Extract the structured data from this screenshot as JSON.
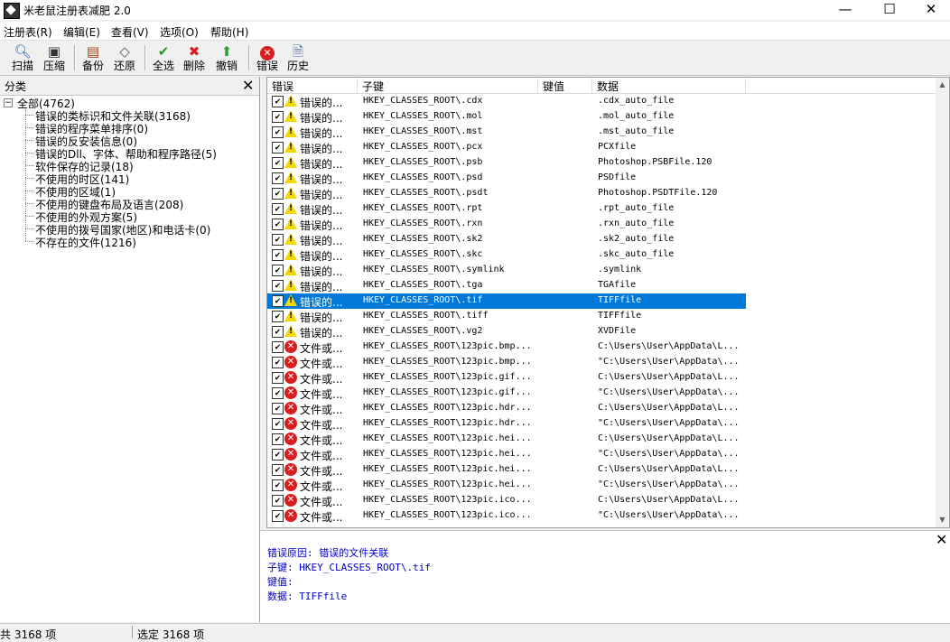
{
  "window": {
    "title": "米老鼠注册表减肥 2.0",
    "minimize": "—",
    "maximize": "☐",
    "close": "✕"
  },
  "menu": [
    "注册表(R)",
    "编辑(E)",
    "查看(V)",
    "选项(O)",
    "帮助(H)"
  ],
  "toolbar": {
    "scan": "扫描",
    "compress": "压缩",
    "backup": "备份",
    "restore": "还原",
    "select_all": "全选",
    "delete": "删除",
    "undo": "撤销",
    "errors": "错误",
    "history": "历史"
  },
  "sidebar": {
    "title": "分类",
    "root": "全部(4762)",
    "items": [
      "错误的类标识和文件关联(3168)",
      "错误的程序菜单排序(0)",
      "错误的反安装信息(0)",
      "错误的Dll、字体、帮助和程序路径(5)",
      "软件保存的记录(18)",
      "不使用的时区(141)",
      "不使用的区域(1)",
      "不使用的键盘布局及语言(208)",
      "不使用的外观方案(5)",
      "不使用的拨号国家(地区)和电话卡(0)",
      "不存在的文件(1216)"
    ]
  },
  "list": {
    "columns": [
      "错误",
      "子键",
      "键值",
      "数据"
    ],
    "rows": [
      {
        "icon": "warning",
        "error": "错误的...",
        "key": "HKEY_CLASSES_ROOT\\.cdx",
        "value": "",
        "data": ".cdx_auto_file"
      },
      {
        "icon": "warning",
        "error": "错误的...",
        "key": "HKEY_CLASSES_ROOT\\.mol",
        "value": "",
        "data": ".mol_auto_file"
      },
      {
        "icon": "warning",
        "error": "错误的...",
        "key": "HKEY_CLASSES_ROOT\\.mst",
        "value": "",
        "data": ".mst_auto_file"
      },
      {
        "icon": "warning",
        "error": "错误的...",
        "key": "HKEY_CLASSES_ROOT\\.pcx",
        "value": "",
        "data": "PCXfile"
      },
      {
        "icon": "warning",
        "error": "错误的...",
        "key": "HKEY_CLASSES_ROOT\\.psb",
        "value": "",
        "data": "Photoshop.PSBFile.120"
      },
      {
        "icon": "warning",
        "error": "错误的...",
        "key": "HKEY_CLASSES_ROOT\\.psd",
        "value": "",
        "data": "PSDfile"
      },
      {
        "icon": "warning",
        "error": "错误的...",
        "key": "HKEY_CLASSES_ROOT\\.psdt",
        "value": "",
        "data": "Photoshop.PSDTFile.120"
      },
      {
        "icon": "warning",
        "error": "错误的...",
        "key": "HKEY_CLASSES_ROOT\\.rpt",
        "value": "",
        "data": ".rpt_auto_file"
      },
      {
        "icon": "warning",
        "error": "错误的...",
        "key": "HKEY_CLASSES_ROOT\\.rxn",
        "value": "",
        "data": ".rxn_auto_file"
      },
      {
        "icon": "warning",
        "error": "错误的...",
        "key": "HKEY_CLASSES_ROOT\\.sk2",
        "value": "",
        "data": ".sk2_auto_file"
      },
      {
        "icon": "warning",
        "error": "错误的...",
        "key": "HKEY_CLASSES_ROOT\\.skc",
        "value": "",
        "data": ".skc_auto_file"
      },
      {
        "icon": "warning",
        "error": "错误的...",
        "key": "HKEY_CLASSES_ROOT\\.symlink",
        "value": "",
        "data": ".symlink"
      },
      {
        "icon": "warning",
        "error": "错误的...",
        "key": "HKEY_CLASSES_ROOT\\.tga",
        "value": "",
        "data": "TGAfile"
      },
      {
        "icon": "warning",
        "error": "错误的...",
        "key": "HKEY_CLASSES_ROOT\\.tif",
        "value": "",
        "data": "TIFFfile",
        "selected": true
      },
      {
        "icon": "warning",
        "error": "错误的...",
        "key": "HKEY_CLASSES_ROOT\\.tiff",
        "value": "",
        "data": "TIFFfile"
      },
      {
        "icon": "warning",
        "error": "错误的...",
        "key": "HKEY_CLASSES_ROOT\\.vg2",
        "value": "",
        "data": "XVDFile"
      },
      {
        "icon": "error",
        "error": "文件或...",
        "key": "HKEY_CLASSES_ROOT\\123pic.bmp...",
        "value": "",
        "data": "C:\\Users\\User\\AppData\\L..."
      },
      {
        "icon": "error",
        "error": "文件或...",
        "key": "HKEY_CLASSES_ROOT\\123pic.bmp...",
        "value": "",
        "data": "\"C:\\Users\\User\\AppData\\..."
      },
      {
        "icon": "error",
        "error": "文件或...",
        "key": "HKEY_CLASSES_ROOT\\123pic.gif...",
        "value": "",
        "data": "C:\\Users\\User\\AppData\\L..."
      },
      {
        "icon": "error",
        "error": "文件或...",
        "key": "HKEY_CLASSES_ROOT\\123pic.gif...",
        "value": "",
        "data": "\"C:\\Users\\User\\AppData\\..."
      },
      {
        "icon": "error",
        "error": "文件或...",
        "key": "HKEY_CLASSES_ROOT\\123pic.hdr...",
        "value": "",
        "data": "C:\\Users\\User\\AppData\\L..."
      },
      {
        "icon": "error",
        "error": "文件或...",
        "key": "HKEY_CLASSES_ROOT\\123pic.hdr...",
        "value": "",
        "data": "\"C:\\Users\\User\\AppData\\..."
      },
      {
        "icon": "error",
        "error": "文件或...",
        "key": "HKEY_CLASSES_ROOT\\123pic.hei...",
        "value": "",
        "data": "C:\\Users\\User\\AppData\\L..."
      },
      {
        "icon": "error",
        "error": "文件或...",
        "key": "HKEY_CLASSES_ROOT\\123pic.hei...",
        "value": "",
        "data": "\"C:\\Users\\User\\AppData\\..."
      },
      {
        "icon": "error",
        "error": "文件或...",
        "key": "HKEY_CLASSES_ROOT\\123pic.hei...",
        "value": "",
        "data": "C:\\Users\\User\\AppData\\L..."
      },
      {
        "icon": "error",
        "error": "文件或...",
        "key": "HKEY_CLASSES_ROOT\\123pic.hei...",
        "value": "",
        "data": "\"C:\\Users\\User\\AppData\\..."
      },
      {
        "icon": "error",
        "error": "文件或...",
        "key": "HKEY_CLASSES_ROOT\\123pic.ico...",
        "value": "",
        "data": "C:\\Users\\User\\AppData\\L..."
      },
      {
        "icon": "error",
        "error": "文件或...",
        "key": "HKEY_CLASSES_ROOT\\123pic.ico...",
        "value": "",
        "data": "\"C:\\Users\\User\\AppData\\..."
      }
    ]
  },
  "detail": {
    "reason": "错误原因: 错误的文件关联",
    "subkey": "子键: HKEY_CLASSES_ROOT\\.tif",
    "value": "键值:",
    "data": "数据: TIFFfile"
  },
  "status": {
    "total": "共 3168 项",
    "selected": "选定 3168 项"
  },
  "colors": {
    "selection": "#0078d7",
    "warning": "#f5d800",
    "error": "#d81e1e",
    "detail_text": "#0000cc"
  }
}
